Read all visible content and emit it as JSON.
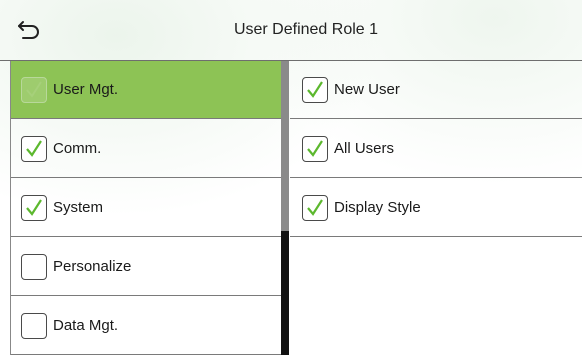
{
  "header": {
    "title": "User Defined Role 1",
    "back_icon": "back-arrow-icon"
  },
  "left_menu": {
    "items": [
      {
        "label": "User Mgt.",
        "checked": true,
        "selected": true
      },
      {
        "label": "Comm.",
        "checked": true,
        "selected": false
      },
      {
        "label": "System",
        "checked": true,
        "selected": false
      },
      {
        "label": "Personalize",
        "checked": false,
        "selected": false
      },
      {
        "label": "Data Mgt.",
        "checked": false,
        "selected": false
      }
    ]
  },
  "right_menu": {
    "items": [
      {
        "label": "New User",
        "checked": true
      },
      {
        "label": "All Users",
        "checked": true
      },
      {
        "label": "Display Style",
        "checked": true
      }
    ]
  },
  "colors": {
    "selected_bg": "#8dc355",
    "check_green": "#5cb82e",
    "scrollbar_track": "#111111",
    "scrollbar_thumb": "#8a8a8a"
  }
}
